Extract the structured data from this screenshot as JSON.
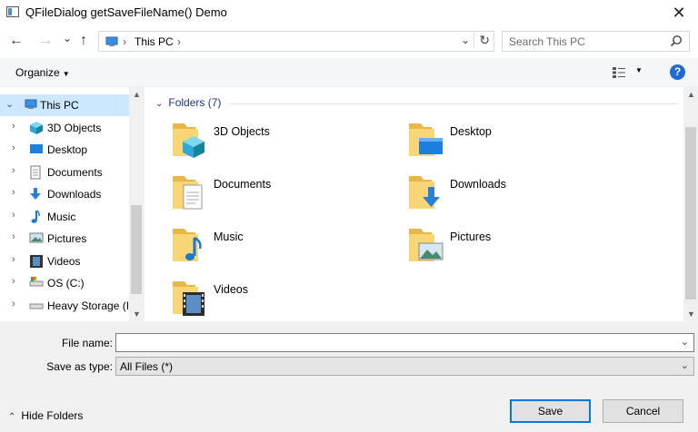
{
  "window": {
    "title": "QFileDialog getSaveFileName() Demo",
    "close_glyph": "✕"
  },
  "nav": {
    "back": "←",
    "forward": "→",
    "recent": "⌄",
    "up": "↑"
  },
  "address": {
    "location": "This PC",
    "dropdown": "⌄",
    "refresh": "↻"
  },
  "search": {
    "placeholder": "Search This PC"
  },
  "toolbar": {
    "organize_label": "Organize",
    "organize_arrow": "▼",
    "view_arrow": "▼",
    "help_glyph": "?"
  },
  "sidebar": {
    "items": [
      {
        "label": "This PC",
        "icon": "computer-icon"
      },
      {
        "label": "3D Objects",
        "icon": "cube-icon"
      },
      {
        "label": "Desktop",
        "icon": "desktop-icon"
      },
      {
        "label": "Documents",
        "icon": "document-icon"
      },
      {
        "label": "Downloads",
        "icon": "download-icon"
      },
      {
        "label": "Music",
        "icon": "music-icon"
      },
      {
        "label": "Pictures",
        "icon": "picture-icon"
      },
      {
        "label": "Videos",
        "icon": "video-icon"
      },
      {
        "label": "OS (C:)",
        "icon": "drive-icon"
      },
      {
        "label": "Heavy Storage (I",
        "icon": "drive-icon"
      }
    ]
  },
  "content": {
    "group_title": "Folders (7)",
    "folders": [
      {
        "name": "3D Objects",
        "icon": "folder-3d-icon"
      },
      {
        "name": "Desktop",
        "icon": "folder-desktop-icon"
      },
      {
        "name": "Documents",
        "icon": "folder-documents-icon"
      },
      {
        "name": "Downloads",
        "icon": "folder-downloads-icon"
      },
      {
        "name": "Music",
        "icon": "folder-music-icon"
      },
      {
        "name": "Pictures",
        "icon": "folder-pictures-icon"
      },
      {
        "name": "Videos",
        "icon": "folder-videos-icon"
      }
    ]
  },
  "form": {
    "filename_label": "File name:",
    "filename_value": "",
    "type_label": "Save as type:",
    "type_value": "All Files  (*)"
  },
  "footer": {
    "hide_folders": "Hide Folders",
    "save": "Save",
    "cancel": "Cancel"
  },
  "colors": {
    "accent": "#0078d7",
    "selection": "#cce8ff",
    "folder": "#f8d675",
    "header_text": "#1e3287"
  }
}
